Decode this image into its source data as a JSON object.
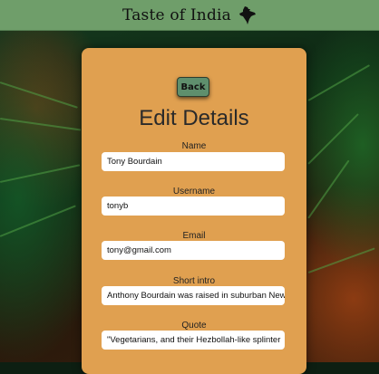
{
  "header": {
    "title": "Taste of India",
    "icon": "india-map-icon"
  },
  "form": {
    "back_label": "Back",
    "title": "Edit Details",
    "fields": [
      {
        "label": "Name",
        "value": "Tony Bourdain"
      },
      {
        "label": "Username",
        "value": "tonyb"
      },
      {
        "label": "Email",
        "value": "tony@gmail.com"
      },
      {
        "label": "Short intro",
        "value": "Anthony Bourdain was raised in suburban New"
      },
      {
        "label": "Quote",
        "value": "\"Vegetarians, and their Hezbollah-like splinter"
      }
    ]
  },
  "colors": {
    "header_bg": "#6f9e6a",
    "card_bg": "#e0a050",
    "button_bg": "#5f8f6d"
  }
}
